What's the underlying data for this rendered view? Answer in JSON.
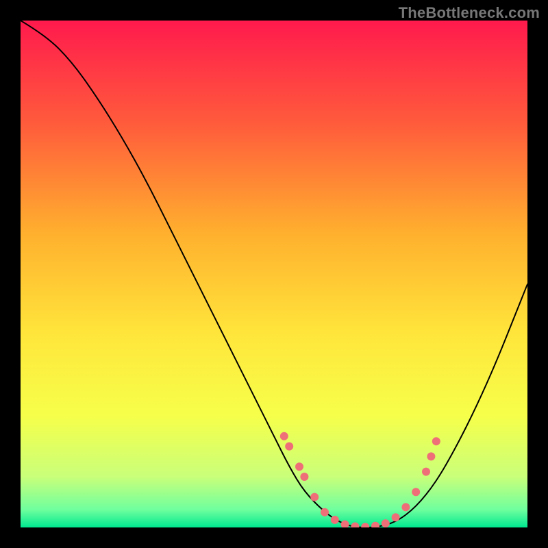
{
  "watermark": "TheBottleneck.com",
  "chart_data": {
    "type": "line",
    "title": "",
    "xlabel": "",
    "ylabel": "",
    "xlim": [
      0,
      100
    ],
    "ylim": [
      0,
      100
    ],
    "grid": false,
    "legend": false,
    "background": {
      "type": "vertical-gradient",
      "stops": [
        {
          "offset": 0.0,
          "color": "#ff1a4d"
        },
        {
          "offset": 0.2,
          "color": "#ff5a3c"
        },
        {
          "offset": 0.42,
          "color": "#ffb02e"
        },
        {
          "offset": 0.62,
          "color": "#ffe63b"
        },
        {
          "offset": 0.78,
          "color": "#f6ff4a"
        },
        {
          "offset": 0.9,
          "color": "#c9ff7a"
        },
        {
          "offset": 0.965,
          "color": "#6fff9e"
        },
        {
          "offset": 1.0,
          "color": "#00e890"
        }
      ]
    },
    "series": [
      {
        "name": "bottleneck-curve",
        "color": "#000000",
        "width": 2,
        "x": [
          0,
          5,
          10,
          15,
          20,
          25,
          30,
          35,
          40,
          45,
          50,
          53,
          56,
          60,
          63,
          66,
          70,
          74,
          78,
          82,
          86,
          90,
          94,
          98,
          100
        ],
        "y": [
          100,
          97,
          92,
          85,
          77,
          68,
          58,
          48,
          38,
          28,
          18,
          12,
          7,
          3,
          1,
          0,
          0,
          1,
          4,
          9,
          16,
          24,
          33,
          43,
          48
        ]
      }
    ],
    "markers": {
      "name": "highlight-points",
      "color": "#ef6f78",
      "radius": 6,
      "points": [
        {
          "x": 52,
          "y": 18
        },
        {
          "x": 53,
          "y": 16
        },
        {
          "x": 55,
          "y": 12
        },
        {
          "x": 56,
          "y": 10
        },
        {
          "x": 58,
          "y": 6
        },
        {
          "x": 60,
          "y": 3
        },
        {
          "x": 62,
          "y": 1.5
        },
        {
          "x": 64,
          "y": 0.6
        },
        {
          "x": 66,
          "y": 0.2
        },
        {
          "x": 68,
          "y": 0.1
        },
        {
          "x": 70,
          "y": 0.3
        },
        {
          "x": 72,
          "y": 0.8
        },
        {
          "x": 74,
          "y": 2
        },
        {
          "x": 76,
          "y": 4
        },
        {
          "x": 78,
          "y": 7
        },
        {
          "x": 80,
          "y": 11
        },
        {
          "x": 81,
          "y": 14
        },
        {
          "x": 82,
          "y": 17
        }
      ]
    }
  }
}
